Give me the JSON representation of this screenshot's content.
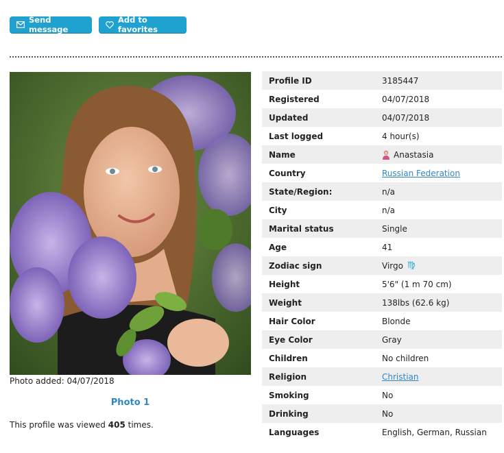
{
  "buttons": {
    "send_message": "Send message",
    "add_favorites": "Add to favorites"
  },
  "photo": {
    "added_label": "Photo added: 04/07/2018",
    "photo_link": "Photo 1"
  },
  "views": {
    "prefix": "This profile was viewed",
    "count": "405",
    "suffix": "times."
  },
  "profile": [
    {
      "label": "Profile ID",
      "value": "3185447"
    },
    {
      "label": "Registered",
      "value": "04/07/2018"
    },
    {
      "label": "Updated",
      "value": "04/07/2018"
    },
    {
      "label": "Last logged",
      "value": "4 hour(s)"
    },
    {
      "label": "Name",
      "value": "Anastasia"
    },
    {
      "label": "Country",
      "value": "Russian Federation"
    },
    {
      "label": "State/Region:",
      "value": "n/a"
    },
    {
      "label": "City",
      "value": "n/a"
    },
    {
      "label": "Marital status",
      "value": "Single"
    },
    {
      "label": "Age",
      "value": "41"
    },
    {
      "label": "Zodiac sign",
      "value": "Virgo",
      "symbol": "♍"
    },
    {
      "label": "Height",
      "value": "5'6\" (1 m 70 cm)"
    },
    {
      "label": "Weight",
      "value": "138lbs (62.6 kg)"
    },
    {
      "label": "Hair Color",
      "value": "Blonde"
    },
    {
      "label": "Eye Color",
      "value": "Gray"
    },
    {
      "label": "Children",
      "value": "No children"
    },
    {
      "label": "Religion",
      "value": "Christian"
    },
    {
      "label": "Smoking",
      "value": "No"
    },
    {
      "label": "Drinking",
      "value": "No"
    },
    {
      "label": "Languages",
      "value": "English, German, Russian"
    }
  ]
}
